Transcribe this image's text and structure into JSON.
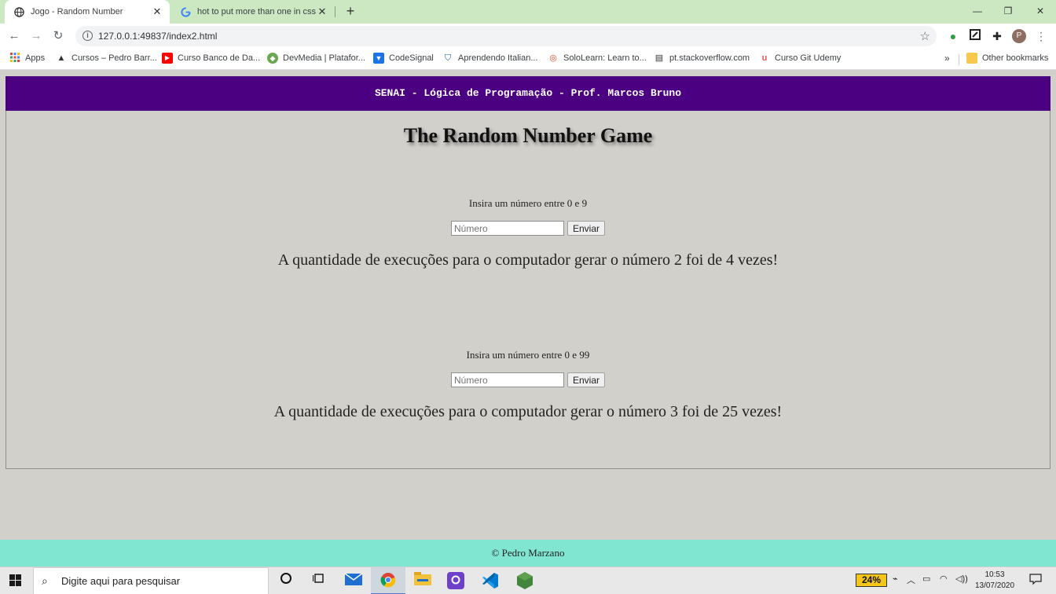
{
  "browser": {
    "tabs": [
      {
        "title": "Jogo - Random Number",
        "active": true,
        "icon": "globe-icon"
      },
      {
        "title": "hot to put more than one in css",
        "active": false,
        "icon": "google-icon"
      }
    ],
    "new_tab": "+",
    "window_controls": {
      "minimize": "—",
      "restore": "❐",
      "close": "✕"
    },
    "nav": {
      "back": "←",
      "forward": "→",
      "reload": "↻"
    },
    "url": "127.0.0.1:49837/index2.html",
    "profile_initial": "P",
    "bookmarks": [
      {
        "label": "Apps",
        "icon": "apps-grid-icon"
      },
      {
        "label": "Cursos – Pedro Barr...",
        "icon": "cap-icon"
      },
      {
        "label": "Curso Banco de Da...",
        "icon": "youtube-icon"
      },
      {
        "label": "DevMedia | Platafor...",
        "icon": "devmedia-icon"
      },
      {
        "label": "CodeSignal",
        "icon": "codesignal-icon"
      },
      {
        "label": "Aprendendo Italian...",
        "icon": "shield-icon"
      },
      {
        "label": "SoloLearn: Learn to...",
        "icon": "sololearn-icon"
      },
      {
        "label": "pt.stackoverflow.com",
        "icon": "stackoverflow-icon"
      },
      {
        "label": "Curso Git Udemy",
        "icon": "udemy-icon"
      }
    ],
    "bookmarks_more": "»",
    "other_bookmarks": "Other bookmarks"
  },
  "page": {
    "header": "SENAI - Lógica de Programação - Prof. Marcos Bruno",
    "title": "The Random Number Game",
    "games": [
      {
        "prompt": "Insira um número entre 0 e 9",
        "placeholder": "Número",
        "button": "Enviar",
        "result": "A quantidade de execuções para o computador gerar o número 2 foi de 4 vezes!"
      },
      {
        "prompt": "Insira um número entre 0 e 99",
        "placeholder": "Número",
        "button": "Enviar",
        "result": "A quantidade de execuções para o computador gerar o número 3 foi de 25 vezes!"
      }
    ],
    "footer": "© Pedro Marzano"
  },
  "taskbar": {
    "search_placeholder": "Digite aqui para pesquisar",
    "battery": "24%",
    "time": "10:53",
    "date": "13/07/2020"
  },
  "colors": {
    "tab_strip": "#cbe8c2",
    "header_bg": "#4b0082",
    "page_bg": "#d2d0cb",
    "footer_bg": "#80e6d2"
  }
}
